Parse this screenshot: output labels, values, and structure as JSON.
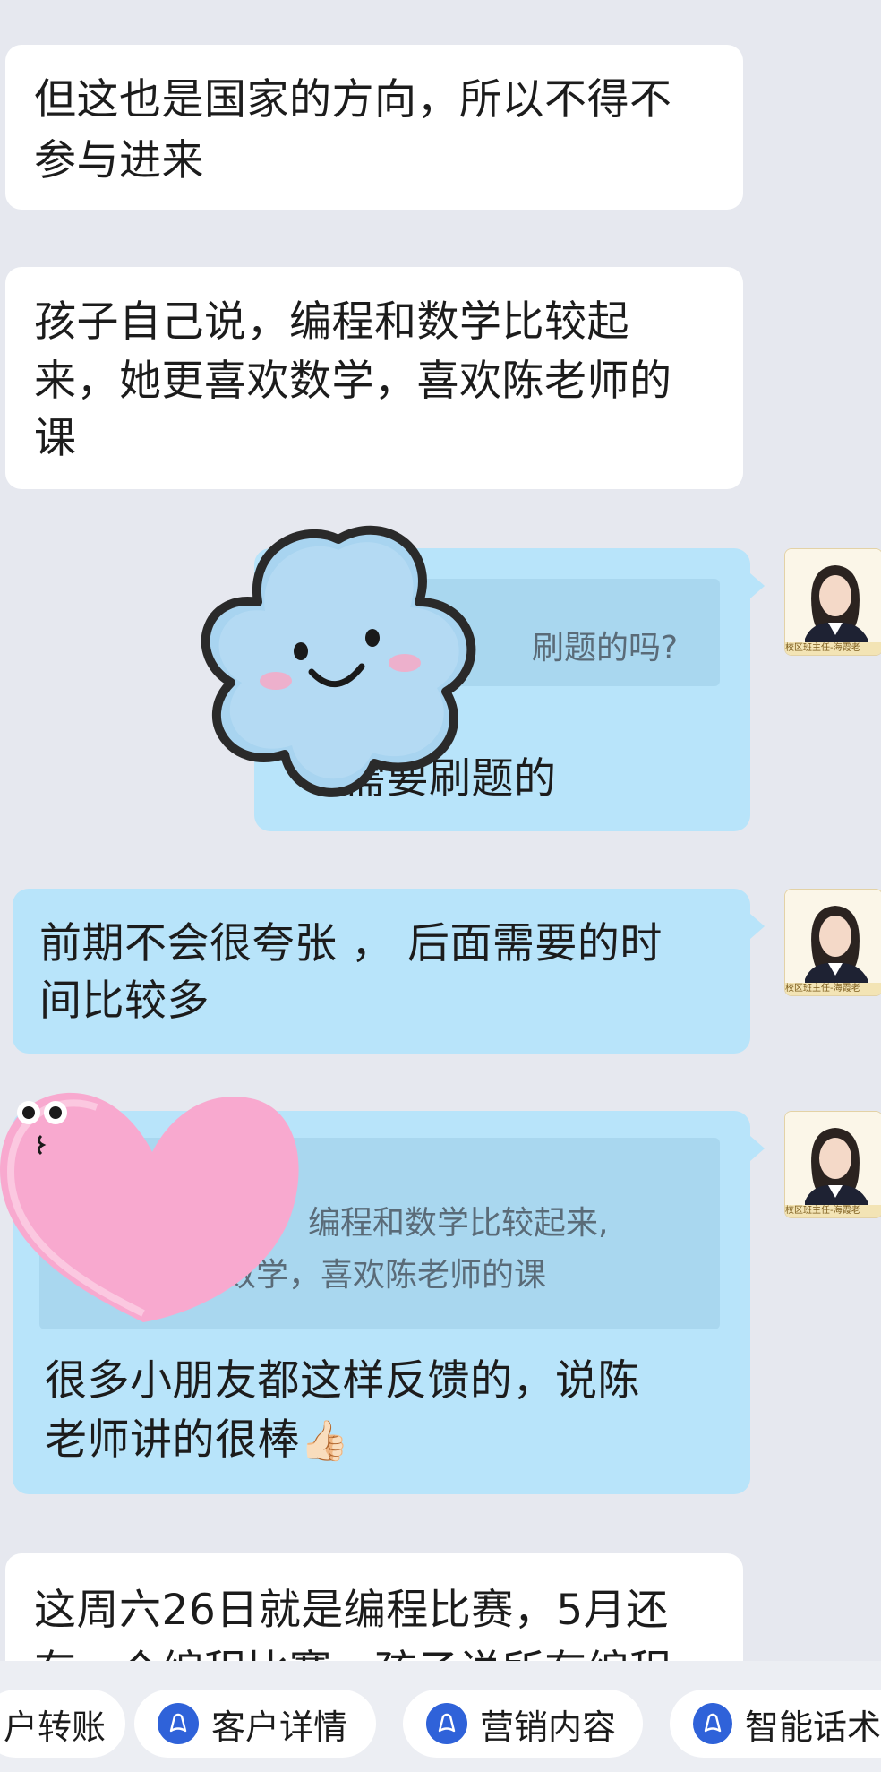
{
  "messages": [
    {
      "text_lines": [
        "但这也是国家的方向，所以不得不",
        "参与进来"
      ]
    },
    {
      "text_lines": [
        "孩子自己说，编程和数学比较起",
        "来，她更喜欢数学，喜欢陈老师的",
        "课"
      ]
    },
    {
      "quote_text": "刷题的吗?",
      "text_lines": [
        "需要刷题的"
      ]
    },
    {
      "text_lines": [
        "前期不会很夸张 ， 后面需要的时",
        "间比较多"
      ]
    },
    {
      "quote_lines": [
        "编程和数学比较起来,",
        "数学，喜欢陈老师的课"
      ],
      "text_lines": [
        "很多小朋友都这样反馈的，说陈",
        "老师讲的很棒"
      ],
      "emoji": "👍🏻"
    },
    {
      "text_lines": [
        "这周六26日就是编程比赛，5月还",
        "有一个编程比赛，孩子说所有编程"
      ]
    }
  ],
  "avatar": {
    "badge": "校区班主任-海霞老"
  },
  "quick_actions": [
    {
      "label": "户转账",
      "icon": "transfer-icon"
    },
    {
      "label": "客户详情",
      "icon": "customer-icon"
    },
    {
      "label": "营销内容",
      "icon": "marketing-icon"
    },
    {
      "label": "智能话术",
      "icon": "script-icon"
    }
  ],
  "colors": {
    "incoming_bubble": "#ffffff",
    "outgoing_bubble": "#b8e4fa",
    "action_icon": "#2f62d9",
    "background": "#e6e8ef"
  }
}
